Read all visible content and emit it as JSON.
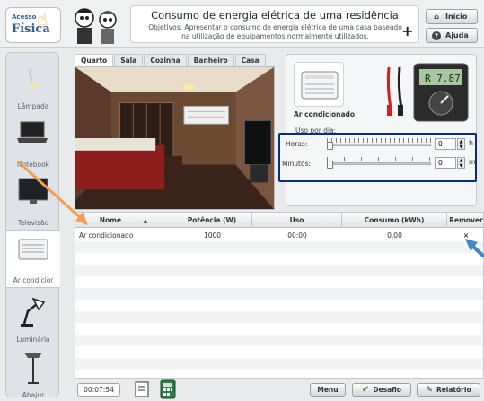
{
  "header": {
    "logo_line1": "Acesso",
    "logo_line2": "Física",
    "title": "Consumo de energia elétrica de uma residência",
    "objectives": "Objetivos: Apresentar o consumo de energia elétrica de uma casa baseado na utilização de equipamentos normalmente utilizados.",
    "plus": "+",
    "home_label": "Início",
    "help_label": "Ajuda"
  },
  "sidebar": {
    "items": [
      {
        "label": "Lâmpada",
        "icon": "lamp-icon"
      },
      {
        "label": "Notebook",
        "icon": "laptop-icon"
      },
      {
        "label": "Televisão",
        "icon": "tv-icon"
      },
      {
        "label": "Ar condicior",
        "icon": "air-conditioner-icon"
      },
      {
        "label": "Luminária",
        "icon": "desk-lamp-icon"
      },
      {
        "label": "Abajur",
        "icon": "floor-lamp-icon"
      }
    ]
  },
  "tabs": [
    "Quarto",
    "Sala",
    "Cozinha",
    "Banheiro",
    "Casa"
  ],
  "panel": {
    "appliance": "Ar condicionado",
    "usage_label": "Uso por dia:",
    "meter_display": "R 7.87",
    "hours_label": "Horas:",
    "hours_value": "0",
    "hours_unit": "h",
    "minutes_label": "Minutos:",
    "minutes_value": "0",
    "minutes_unit": "m"
  },
  "table": {
    "headers": [
      "Nome",
      "Potência (W)",
      "Uso",
      "Consumo (kWh)",
      "Remover"
    ],
    "sort_indicator": "▲",
    "rows": [
      {
        "name": "Ar condicionado",
        "power": "1000",
        "usage": "00:00",
        "consumption": "0,00",
        "remove": "×"
      }
    ]
  },
  "footer": {
    "timer": "00:07:54",
    "menu_label": "Menu",
    "challenge_label": "Desafio",
    "report_label": "Relatório"
  },
  "colors": {
    "highlight_box": "#0b2f6e",
    "orange_arrow": "#f0a050",
    "blue_arrow": "#3f86c7"
  }
}
